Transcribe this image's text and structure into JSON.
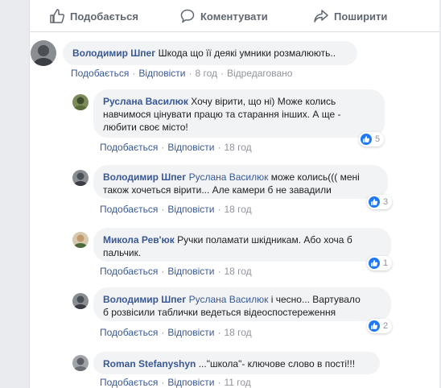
{
  "actions": {
    "like": "Подобається",
    "comment": "Коментувати",
    "share": "Поширити"
  },
  "comments": [
    {
      "author": "Володимир Шпег",
      "mention": "",
      "text": "Шкода що її деякі умники розмалюють..",
      "like": "Подобається",
      "reply": "Відповісти",
      "time": "8 год",
      "edited": "Відредаговано",
      "likes": ""
    },
    {
      "author": "Руслана Василюк",
      "mention": "",
      "text_line1": "Хочу вірити, що ні) Може колись",
      "text_line2": "навчимося цінувати працю та старання інших. А ще -",
      "text_line3": "любити своє місто!",
      "like": "Подобається",
      "reply": "Відповісти",
      "time": "18 год",
      "likes": "5"
    },
    {
      "author": "Володимир Шпег",
      "mention": "Руслана Василюк",
      "text_line1": "може колись((( мені",
      "text_line2": "також хочеться вірити... Але камери б не завадили",
      "like": "Подобається",
      "reply": "Відповісти",
      "time": "18 год",
      "likes": "3"
    },
    {
      "author": "Микола Рев'юк",
      "mention": "",
      "text_line1": "Ручки поламати шкідникам. Або хоча б",
      "text_line2": "пальчик.",
      "like": "Подобається",
      "reply": "Відповісти",
      "time": "18 год",
      "likes": "1"
    },
    {
      "author": "Володимир Шпег",
      "mention": "Руслана Василюк",
      "text_line1": "і чесно... Вартувало",
      "text_line2": "б розвісили таблички ведеться відеоспостереження",
      "like": "Подобається",
      "reply": "Відповісти",
      "time": "18 год",
      "likes": "2"
    },
    {
      "author": "Roman Stefanyshyn",
      "mention": "",
      "text": "...\"школа\"- ключове слово в пості!!!",
      "like": "Подобається",
      "reply": "Відповісти",
      "time": "11 год",
      "likes": ""
    }
  ],
  "colors": {
    "link": "#385898",
    "meta": "#90949c",
    "bubble": "#f2f3f5",
    "like_badge": "#2078f4"
  }
}
